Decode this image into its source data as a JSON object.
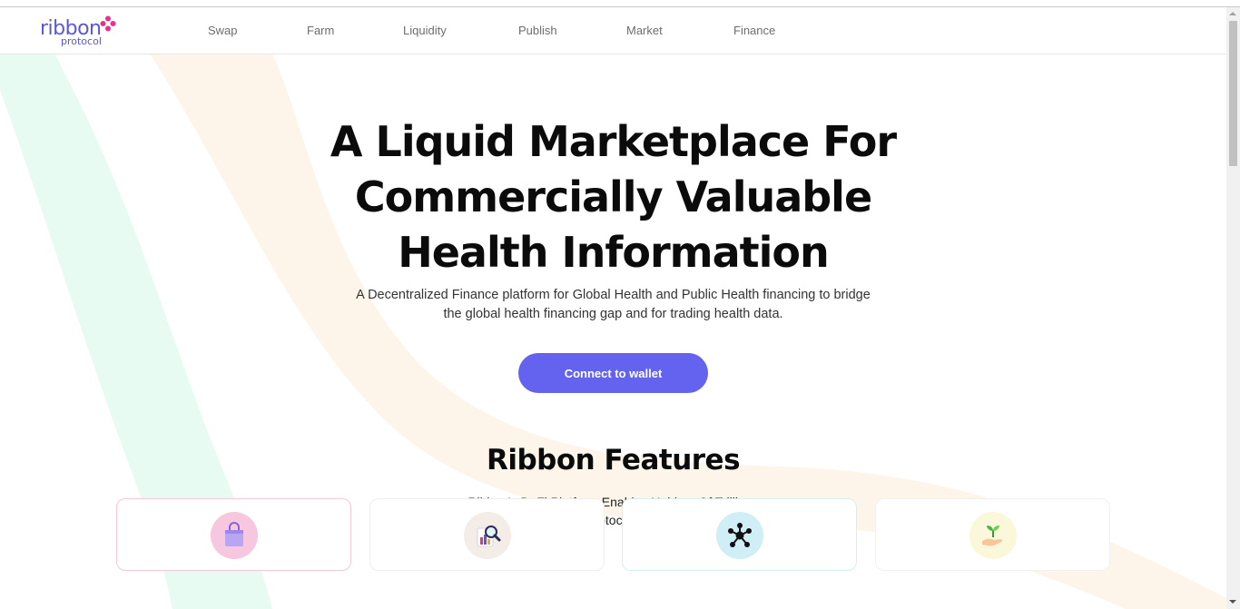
{
  "logo": {
    "main": "ribbon",
    "sub": "protocol"
  },
  "nav": [
    {
      "label": "Swap"
    },
    {
      "label": "Farm"
    },
    {
      "label": "Liquidity"
    },
    {
      "label": "Publish"
    },
    {
      "label": "Market"
    },
    {
      "label": "Finance"
    }
  ],
  "hero": {
    "title_line1": "A Liquid Marketplace For",
    "title_line2": "Commercially Valuable",
    "title_line3": "Health Information",
    "desc_line1": "A Decentralized Finance platform for Global Health and Public Health financing to bridge",
    "desc_line2": "the global health financing gap and for trading health data.",
    "cta_label": "Connect to wallet"
  },
  "features": {
    "title": "Ribbon Features",
    "sub_line1": "Ribbon's DeFi Platform Enables Holders Of Trillions",
    "sub_line2": "Worth Of Cryptocurrencies To...",
    "cards": [
      {
        "icon": "shopping-bag-icon",
        "border": "#f4c7dc",
        "bg": "#f7c6df"
      },
      {
        "icon": "data-search-icon",
        "border": "#eeeeee",
        "bg": "#f3ece7"
      },
      {
        "icon": "network-nodes-icon",
        "border": "#d6eef1",
        "bg": "#cfeef5"
      },
      {
        "icon": "hand-sprout-icon",
        "border": "#f1f1f1",
        "bg": "#fbf7da"
      }
    ]
  },
  "colors": {
    "accent": "#6363f0",
    "brand": "#5b57d9",
    "ribbon_green": "#e6fbf1",
    "ribbon_peach": "#fdf4e8"
  }
}
